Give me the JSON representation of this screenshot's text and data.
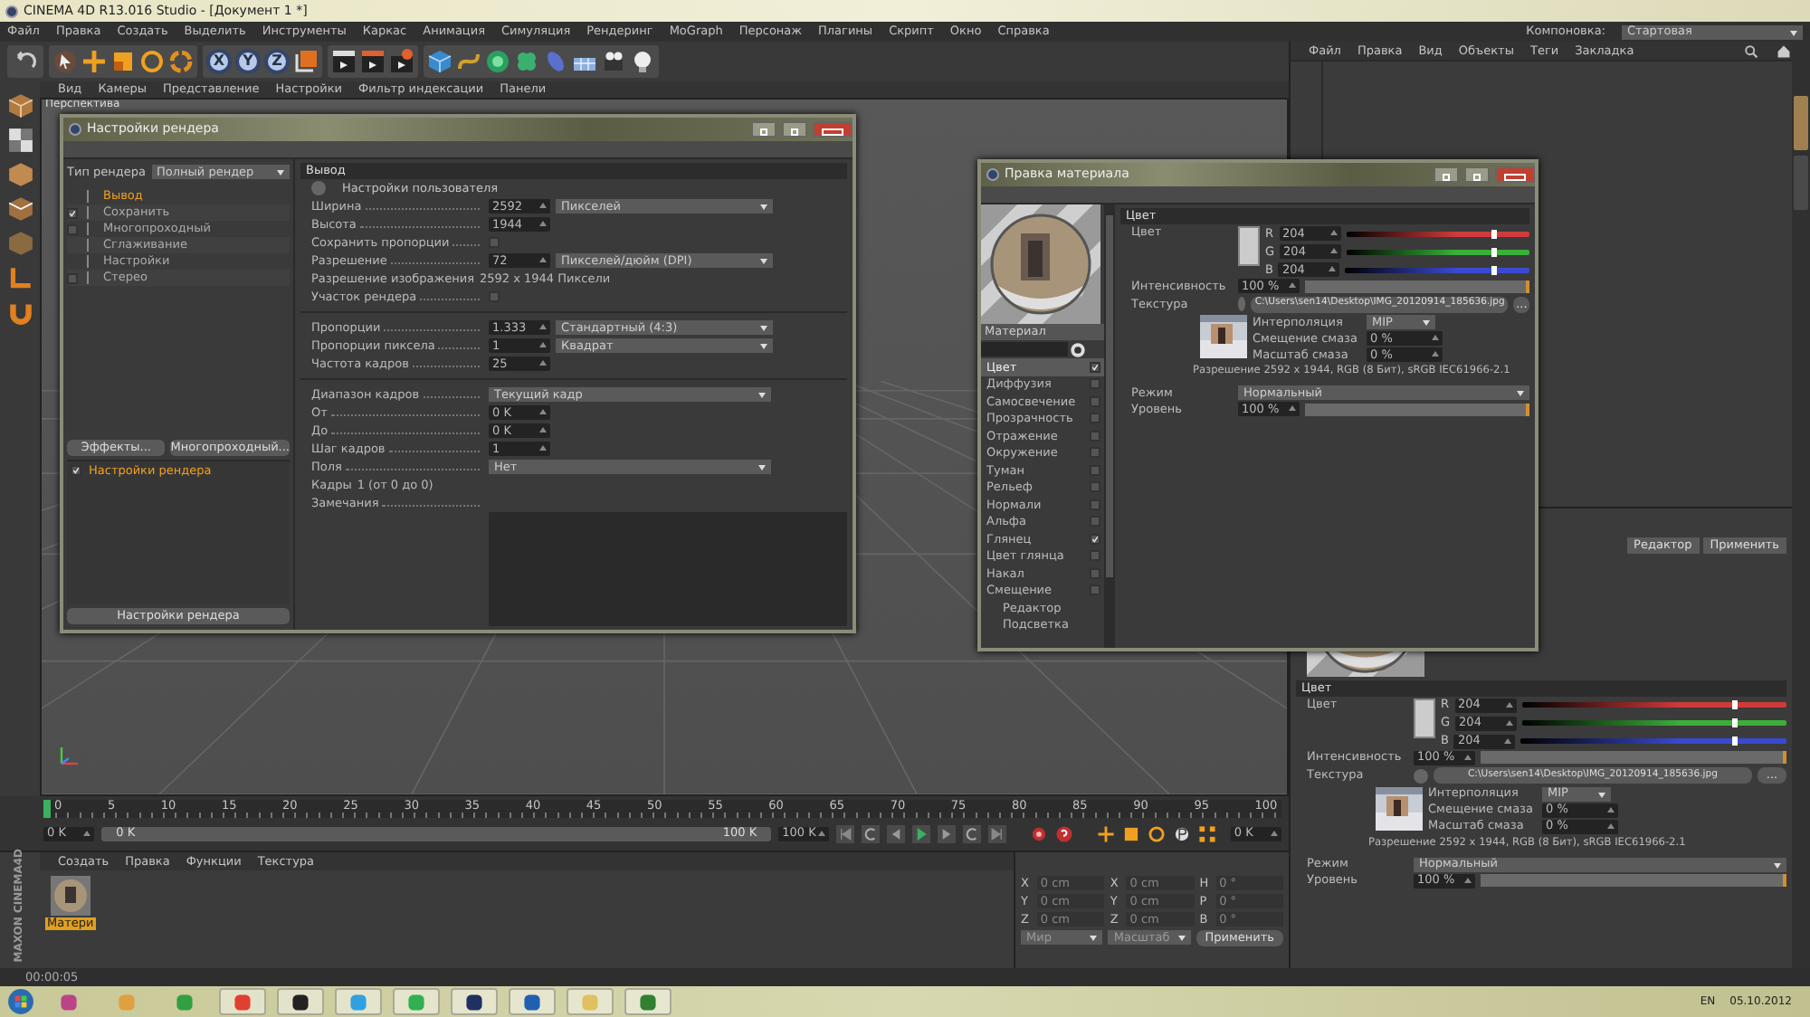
{
  "window": {
    "title": "CINEMA 4D R13.016 Studio - [Документ 1 *]"
  },
  "menu": [
    "Файл",
    "Правка",
    "Создать",
    "Выделить",
    "Инструменты",
    "Каркас",
    "Анимация",
    "Симуляция",
    "Рендеринг",
    "MoGraph",
    "Персонаж",
    "Плагины",
    "Скрипт",
    "Окно",
    "Справка"
  ],
  "layout": {
    "label": "Компоновка:",
    "value": "Стартовая"
  },
  "toolbar": {
    "axes": [
      "X",
      "Y",
      "Z"
    ]
  },
  "viewport": {
    "menu": [
      "Вид",
      "Камеры",
      "Представление",
      "Настройки",
      "Фильтр индексации",
      "Панели"
    ],
    "label": "Перспектива"
  },
  "object_manager": {
    "menu": [
      "Файл",
      "Правка",
      "Вид",
      "Объекты",
      "Теги",
      "Закладка"
    ]
  },
  "render_settings": {
    "title": "Настройки рендера",
    "renderer_label": "Тип рендера",
    "renderer": "Полный рендер",
    "tree": [
      {
        "label": "Вывод",
        "kind": "plain",
        "selected": true
      },
      {
        "label": "Сохранить",
        "kind": "checkbox",
        "checked": true,
        "selected": false
      },
      {
        "label": "Многопроходный",
        "kind": "checkbox",
        "checked": false,
        "selected": false
      },
      {
        "label": "Сглаживание",
        "kind": "plain",
        "selected": false
      },
      {
        "label": "Настройки",
        "kind": "plain",
        "selected": false
      },
      {
        "label": "Стерео",
        "kind": "checkbox",
        "checked": false,
        "selected": false
      }
    ],
    "buttons": [
      "Эффекты...",
      "Многопроходный..."
    ],
    "list": [
      {
        "label": "Настройки рендера",
        "checked": true
      }
    ],
    "bottom_button": "Настройки рендера",
    "header": "Вывод",
    "preset": "Настройки пользователя",
    "groups": [
      [
        {
          "kind": "number_select",
          "label": "Ширина",
          "value": "2592",
          "option": "Пикселей"
        },
        {
          "kind": "number",
          "label": "Высота",
          "value": "1944"
        },
        {
          "kind": "checkbox",
          "label": "Сохранить пропорции",
          "checked": false
        },
        {
          "kind": "number_select",
          "label": "Разрешение",
          "value": "72",
          "option": "Пикселей/дюйм (DPI)"
        },
        {
          "kind": "text",
          "label": "Разрешение изображения",
          "value": "2592 x 1944 Пиксели"
        },
        {
          "kind": "checkbox",
          "label": "Участок рендера",
          "checked": false
        }
      ],
      [
        {
          "kind": "number_select",
          "label": "Пропорции",
          "value": "1.333",
          "option": "Стандартный (4:3)"
        },
        {
          "kind": "number_select",
          "label": "Пропорции пиксела",
          "value": "1",
          "option": "Квадрат"
        },
        {
          "kind": "number",
          "label": "Частота кадров",
          "value": "25"
        }
      ],
      [
        {
          "kind": "select",
          "label": "Диапазон кадров",
          "option": "Текущий кадр"
        },
        {
          "kind": "number",
          "label": "От",
          "value": "0 K"
        },
        {
          "kind": "number",
          "label": "До",
          "value": "0 K"
        },
        {
          "kind": "number",
          "label": "Шаг кадров",
          "value": "1"
        },
        {
          "kind": "select",
          "label": "Поля",
          "option": "Нет"
        },
        {
          "kind": "text",
          "label": "Кадры",
          "value": "1 (от 0 до 0)"
        },
        {
          "kind": "textarea",
          "label": "Замечания"
        }
      ]
    ]
  },
  "material_editor": {
    "title": "Правка материала",
    "list_header": "Материал",
    "channels": [
      {
        "label": "Цвет",
        "kind": "checkbox",
        "checked": true,
        "selected": true
      },
      {
        "label": "Диффузия",
        "kind": "checkbox",
        "checked": false,
        "selected": false
      },
      {
        "label": "Самосвечение",
        "kind": "checkbox",
        "checked": false,
        "selected": false
      },
      {
        "label": "Прозрачность",
        "kind": "checkbox",
        "checked": false,
        "selected": false
      },
      {
        "label": "Отражение",
        "kind": "checkbox",
        "checked": false,
        "selected": false
      },
      {
        "label": "Окружение",
        "kind": "checkbox",
        "checked": false,
        "selected": false
      },
      {
        "label": "Туман",
        "kind": "checkbox",
        "checked": false,
        "selected": false
      },
      {
        "label": "Рельеф",
        "kind": "checkbox",
        "checked": false,
        "selected": false
      },
      {
        "label": "Нормали",
        "kind": "checkbox",
        "checked": false,
        "selected": false
      },
      {
        "label": "Альфа",
        "kind": "checkbox",
        "checked": false,
        "selected": false
      },
      {
        "label": "Глянец",
        "kind": "checkbox",
        "checked": true,
        "selected": false
      },
      {
        "label": "Цвет глянца",
        "kind": "checkbox",
        "checked": false,
        "selected": false
      },
      {
        "label": "Накал",
        "kind": "checkbox",
        "checked": false,
        "selected": false
      },
      {
        "label": "Смещение",
        "kind": "checkbox",
        "checked": false,
        "selected": false
      },
      {
        "label": "Редактор",
        "kind": "plain",
        "selected": false
      },
      {
        "label": "Подсветка",
        "kind": "plain",
        "selected": false
      }
    ],
    "color": {
      "header": "Цвет",
      "label": "Цвет",
      "channels": [
        {
          "name": "R",
          "value": "204",
          "level": 0.8,
          "color": "#d03a3a"
        },
        {
          "name": "G",
          "value": "204",
          "level": 0.8,
          "color": "#3ab03a"
        },
        {
          "name": "B",
          "value": "204",
          "level": 0.8,
          "color": "#3a4ad0"
        }
      ],
      "intensity": {
        "label": "Интенсивность",
        "value": "100 %",
        "level": 1
      },
      "texture": {
        "label": "Текстура",
        "path": "C:\\Users\\sen14\\Desktop\\IMG_20120914_185636.jpg",
        "browse": "..."
      },
      "params": [
        {
          "label": "Интерполяция",
          "kind": "select",
          "value": "MIP"
        },
        {
          "label": "Смещение смаза",
          "kind": "number",
          "value": "0 %"
        },
        {
          "label": "Масштаб смаза",
          "kind": "number",
          "value": "0 %"
        }
      ],
      "info": "Разрешение 2592 x 1944, RGB (8 Бит), sRGB IEC61966-2.1",
      "mode": {
        "label": "Режим",
        "value": "Нормальный"
      },
      "level": {
        "label": "Уровень",
        "value": "100 %",
        "level": 1
      }
    }
  },
  "attributes": {
    "buttons": [
      "Редактор",
      "Применить"
    ],
    "color": {
      "header": "Цвет",
      "label": "Цвет",
      "channels": [
        {
          "name": "R",
          "value": "204",
          "level": 0.8,
          "color": "#d03a3a"
        },
        {
          "name": "G",
          "value": "204",
          "level": 0.8,
          "color": "#3ab03a"
        },
        {
          "name": "B",
          "value": "204",
          "level": 0.8,
          "color": "#3a4ad0"
        }
      ],
      "intensity": {
        "label": "Интенсивность",
        "value": "100 %",
        "level": 1
      },
      "texture": {
        "label": "Текстура",
        "path": "C:\\Users\\sen14\\Desktop\\IMG_20120914_185636.jpg",
        "browse": "..."
      },
      "params": [
        {
          "label": "Интерполяция",
          "kind": "select",
          "value": "MIP"
        },
        {
          "label": "Смещение смаза",
          "kind": "number",
          "value": "0 %"
        },
        {
          "label": "Масштаб смаза",
          "kind": "number",
          "value": "0 %"
        }
      ],
      "info": "Разрешение 2592 x 1944, RGB (8 Бит), sRGB IEC61966-2.1",
      "mode": {
        "label": "Режим",
        "value": "Нормальный"
      },
      "level": {
        "label": "Уровень",
        "value": "100 %",
        "level": 1
      }
    }
  },
  "timeline": {
    "ticks": [
      "0",
      "5",
      "10",
      "15",
      "20",
      "25",
      "30",
      "35",
      "40",
      "45",
      "50",
      "55",
      "60",
      "65",
      "70",
      "75",
      "80",
      "85",
      "90",
      "95",
      "100"
    ],
    "current": "0 K",
    "start": "0 K",
    "range_start": "0 K",
    "range_end": "100 K",
    "end": "100 K"
  },
  "material_manager": {
    "menu": [
      "Создать",
      "Правка",
      "Функции",
      "Текстура"
    ],
    "materials": [
      {
        "name": "Матери",
        "selected": true
      }
    ]
  },
  "coordinates": {
    "rows": [
      [
        "X",
        "0 cm",
        "X",
        "0 cm",
        "H",
        "0 °"
      ],
      [
        "Y",
        "0 cm",
        "Y",
        "0 cm",
        "P",
        "0 °"
      ],
      [
        "Z",
        "0 cm",
        "Z",
        "0 cm",
        "B",
        "0 °"
      ]
    ],
    "selects": [
      "Мир",
      "Масштаб"
    ],
    "apply": "Применить"
  },
  "logo": "MAXON CINEMA4D",
  "status": "00:00:05",
  "tray": {
    "language": "EN",
    "date": "05.10.2012"
  }
}
